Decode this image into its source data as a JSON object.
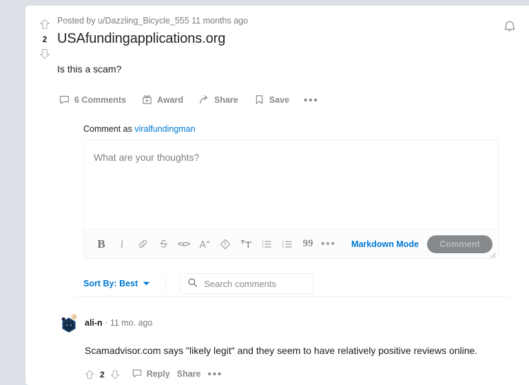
{
  "post": {
    "byline_prefix": "Posted by",
    "author": "u/Dazzling_Bicycle_555",
    "age": "11 months ago",
    "title": "USAfundingapplications.org",
    "body": "Is this a scam?",
    "score": "2",
    "actions": {
      "comments": "6 Comments",
      "award": "Award",
      "share": "Share",
      "save": "Save",
      "more": "•••"
    },
    "icons": {
      "upvote": "upvote-arrow-icon",
      "downvote": "downvote-arrow-icon",
      "comments": "comment-bubble-icon",
      "award": "gift-award-icon",
      "share": "share-arrow-icon",
      "save": "bookmark-icon",
      "more": "more-options-icon"
    }
  },
  "header": {
    "bell_icon": "notification-bell-icon"
  },
  "composer": {
    "comment_as_prefix": "Comment as",
    "username": "viralfundingman",
    "placeholder": "What are your thoughts?",
    "markdown_mode": "Markdown Mode",
    "submit_label": "Comment",
    "toolbar": {
      "bold": "B",
      "italic": "i",
      "link_icon": "link-chain-icon",
      "strikethrough": "strikethrough-icon",
      "inline_code": "<c>",
      "superscript": "superscript-icon",
      "spoiler_icon": "spoiler-exclamation-icon",
      "heading_icon": "heading-text-icon",
      "bulleted_list_icon": "bulleted-list-icon",
      "numbered_list_icon": "numbered-list-icon",
      "quote": "99",
      "more": "•••"
    }
  },
  "sort": {
    "label": "Sort By: Best",
    "caret_icon": "chevron-down-icon",
    "search_placeholder": "Search comments",
    "search_value": "",
    "search_icon": "search-icon"
  },
  "comments": [
    {
      "author": "ali-n",
      "separator": "·",
      "age": "11 mo. ago",
      "body": "Scamadvisor.com says \"likely legit\" and they seem to have relatively positive reviews online.",
      "score": "2",
      "reply_label": "Reply",
      "share_label": "Share",
      "more_label": "•••"
    }
  ],
  "colors": {
    "page_background": "#dae0e6",
    "card_background": "#ffffff",
    "link_blue": "#0079d3",
    "muted_text": "#787c7e",
    "icon_gray": "#878a8c",
    "primary_text": "#1a1a1b",
    "disabled_button": "#878a8c",
    "disabled_button_text": "#b9bbbd"
  }
}
